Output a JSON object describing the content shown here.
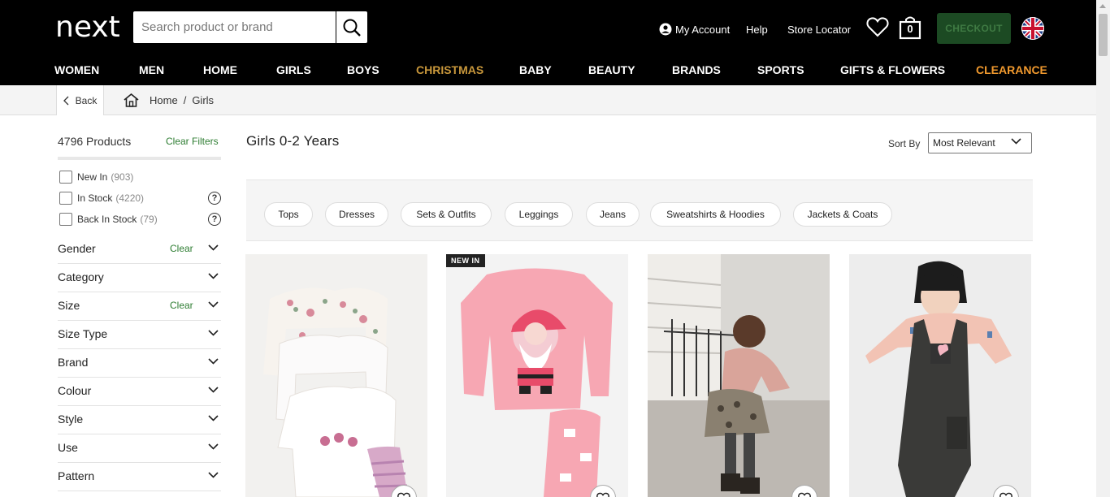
{
  "header": {
    "logo": "next",
    "search_placeholder": "Search product or brand",
    "my_account": "My Account",
    "help": "Help",
    "store_locator": "Store Locator",
    "bag_count": "0",
    "checkout": "CHECKOUT"
  },
  "nav": [
    "WOMEN",
    "MEN",
    "HOME",
    "GIRLS",
    "BOYS",
    "CHRISTMAS",
    "BABY",
    "BEAUTY",
    "BRANDS",
    "SPORTS",
    "GIFTS & FLOWERS",
    "CLEARANCE"
  ],
  "colors": {
    "christmas": "#c8973b",
    "clearance": "#f29a2e",
    "accent_green": "#2e7d32",
    "checkout_bg": "#1c4a23"
  },
  "breadcrumb": {
    "back": "Back",
    "home": "Home",
    "separator": "/",
    "current": "Girls"
  },
  "sidebar": {
    "product_count": "4796 Products",
    "clear_filters": "Clear Filters",
    "checkboxes": [
      {
        "label": "New In",
        "count": "(903)"
      },
      {
        "label": "In Stock",
        "count": "(4220)"
      },
      {
        "label": "Back In Stock",
        "count": "(79)"
      }
    ],
    "help_icon": "?",
    "facets": [
      {
        "label": "Gender",
        "clear": "Clear"
      },
      {
        "label": "Category",
        "clear": ""
      },
      {
        "label": "Size",
        "clear": "Clear"
      },
      {
        "label": "Size Type",
        "clear": ""
      },
      {
        "label": "Brand",
        "clear": ""
      },
      {
        "label": "Colour",
        "clear": ""
      },
      {
        "label": "Style",
        "clear": ""
      },
      {
        "label": "Use",
        "clear": ""
      },
      {
        "label": "Pattern",
        "clear": ""
      }
    ]
  },
  "main": {
    "title": "Girls 0-2 Years",
    "sort_label": "Sort By",
    "sort_value": "Most Relevant",
    "chips": [
      "Tops",
      "Dresses",
      "Sets & Outfits",
      "Leggings",
      "Jeans",
      "Sweatshirts & Hoodies",
      "Jackets & Coats"
    ],
    "products": [
      {
        "badge": ""
      },
      {
        "badge": "NEW IN"
      },
      {
        "badge": ""
      },
      {
        "badge": ""
      }
    ]
  }
}
